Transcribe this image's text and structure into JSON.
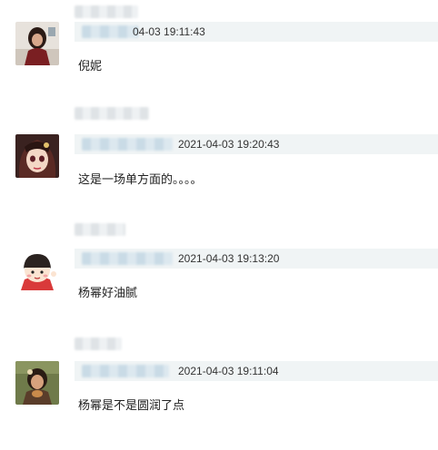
{
  "comments": [
    {
      "timestamp": "04-03 19:11:43",
      "text": "倪妮"
    },
    {
      "timestamp": "2021-04-03 19:20:43",
      "text": "这是一场单方面的。。。。"
    },
    {
      "timestamp": "2021-04-03 19:13:20",
      "text": "杨幂好油腻"
    },
    {
      "timestamp": "2021-04-03 19:11:04",
      "text": "杨幂是不是圆润了点"
    }
  ],
  "icons": {
    "avatar_1": "user-avatar-photo-icon",
    "avatar_2": "user-avatar-cartoon-girl-icon",
    "avatar_3": "user-avatar-chibi-cartoon-icon",
    "avatar_4": "user-avatar-photo-icon"
  },
  "colors": {
    "meta_bar": "#f0f4f5",
    "blurred_username": "#c9dbe6",
    "text": "#222222"
  }
}
